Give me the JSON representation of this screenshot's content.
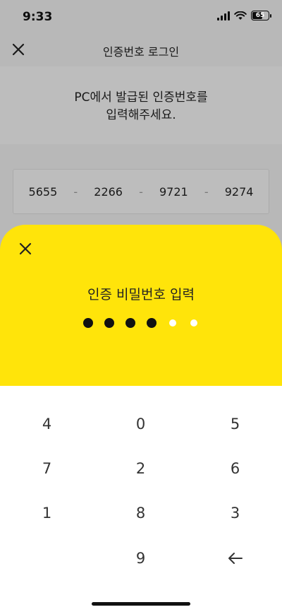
{
  "status_bar": {
    "time": "9:33",
    "battery": "65"
  },
  "header": {
    "title": "인증번호 로그인"
  },
  "instruction": {
    "line1": "PC에서 발급된 인증번호를",
    "line2": "입력해주세요."
  },
  "code": {
    "segments": [
      "5655",
      "2266",
      "9721",
      "9274"
    ],
    "separator": "-"
  },
  "sheet": {
    "title": "인증 비밀번호 입력",
    "pin_filled": 4,
    "pin_total": 6
  },
  "keypad": {
    "keys": [
      "4",
      "0",
      "5",
      "7",
      "2",
      "6",
      "1",
      "8",
      "3",
      "",
      "9",
      "backspace"
    ]
  },
  "colors": {
    "accent_yellow": "#ffe40a",
    "dim_overlay": "#000000"
  }
}
